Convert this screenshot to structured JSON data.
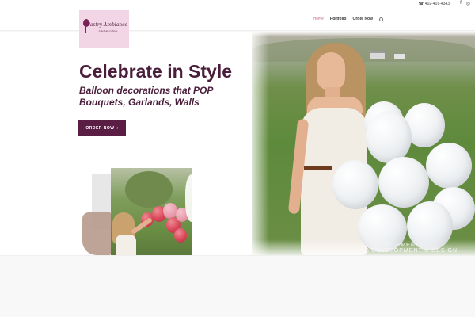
{
  "topbar": {
    "phone": "402-401-4343",
    "social": [
      "f",
      "ig"
    ]
  },
  "logo": {
    "brand": "Pastry Ambiance",
    "tagline": "Celebrate in Style"
  },
  "nav": {
    "items": [
      {
        "label": "Home",
        "active": true
      },
      {
        "label": "Portfolio",
        "active": false
      },
      {
        "label": "Order Now",
        "active": false
      }
    ]
  },
  "hero": {
    "headline": "Celebrate in Style",
    "subhead_line1": "Balloon decorations that POP",
    "subhead_line2": "Bouquets, Garlands, Walls",
    "cta_label": "ORDER NOW",
    "cta_arrow": "›"
  },
  "watermark": {
    "line1": "ELEMENTS",
    "line2": "WEB DEVELOPMENT & DESIGN"
  },
  "colors": {
    "brand_plum": "#4a1d3a",
    "cta_bg": "#5a1e44",
    "nav_active": "#c8739e",
    "logo_bg": "#f3d6e6"
  }
}
